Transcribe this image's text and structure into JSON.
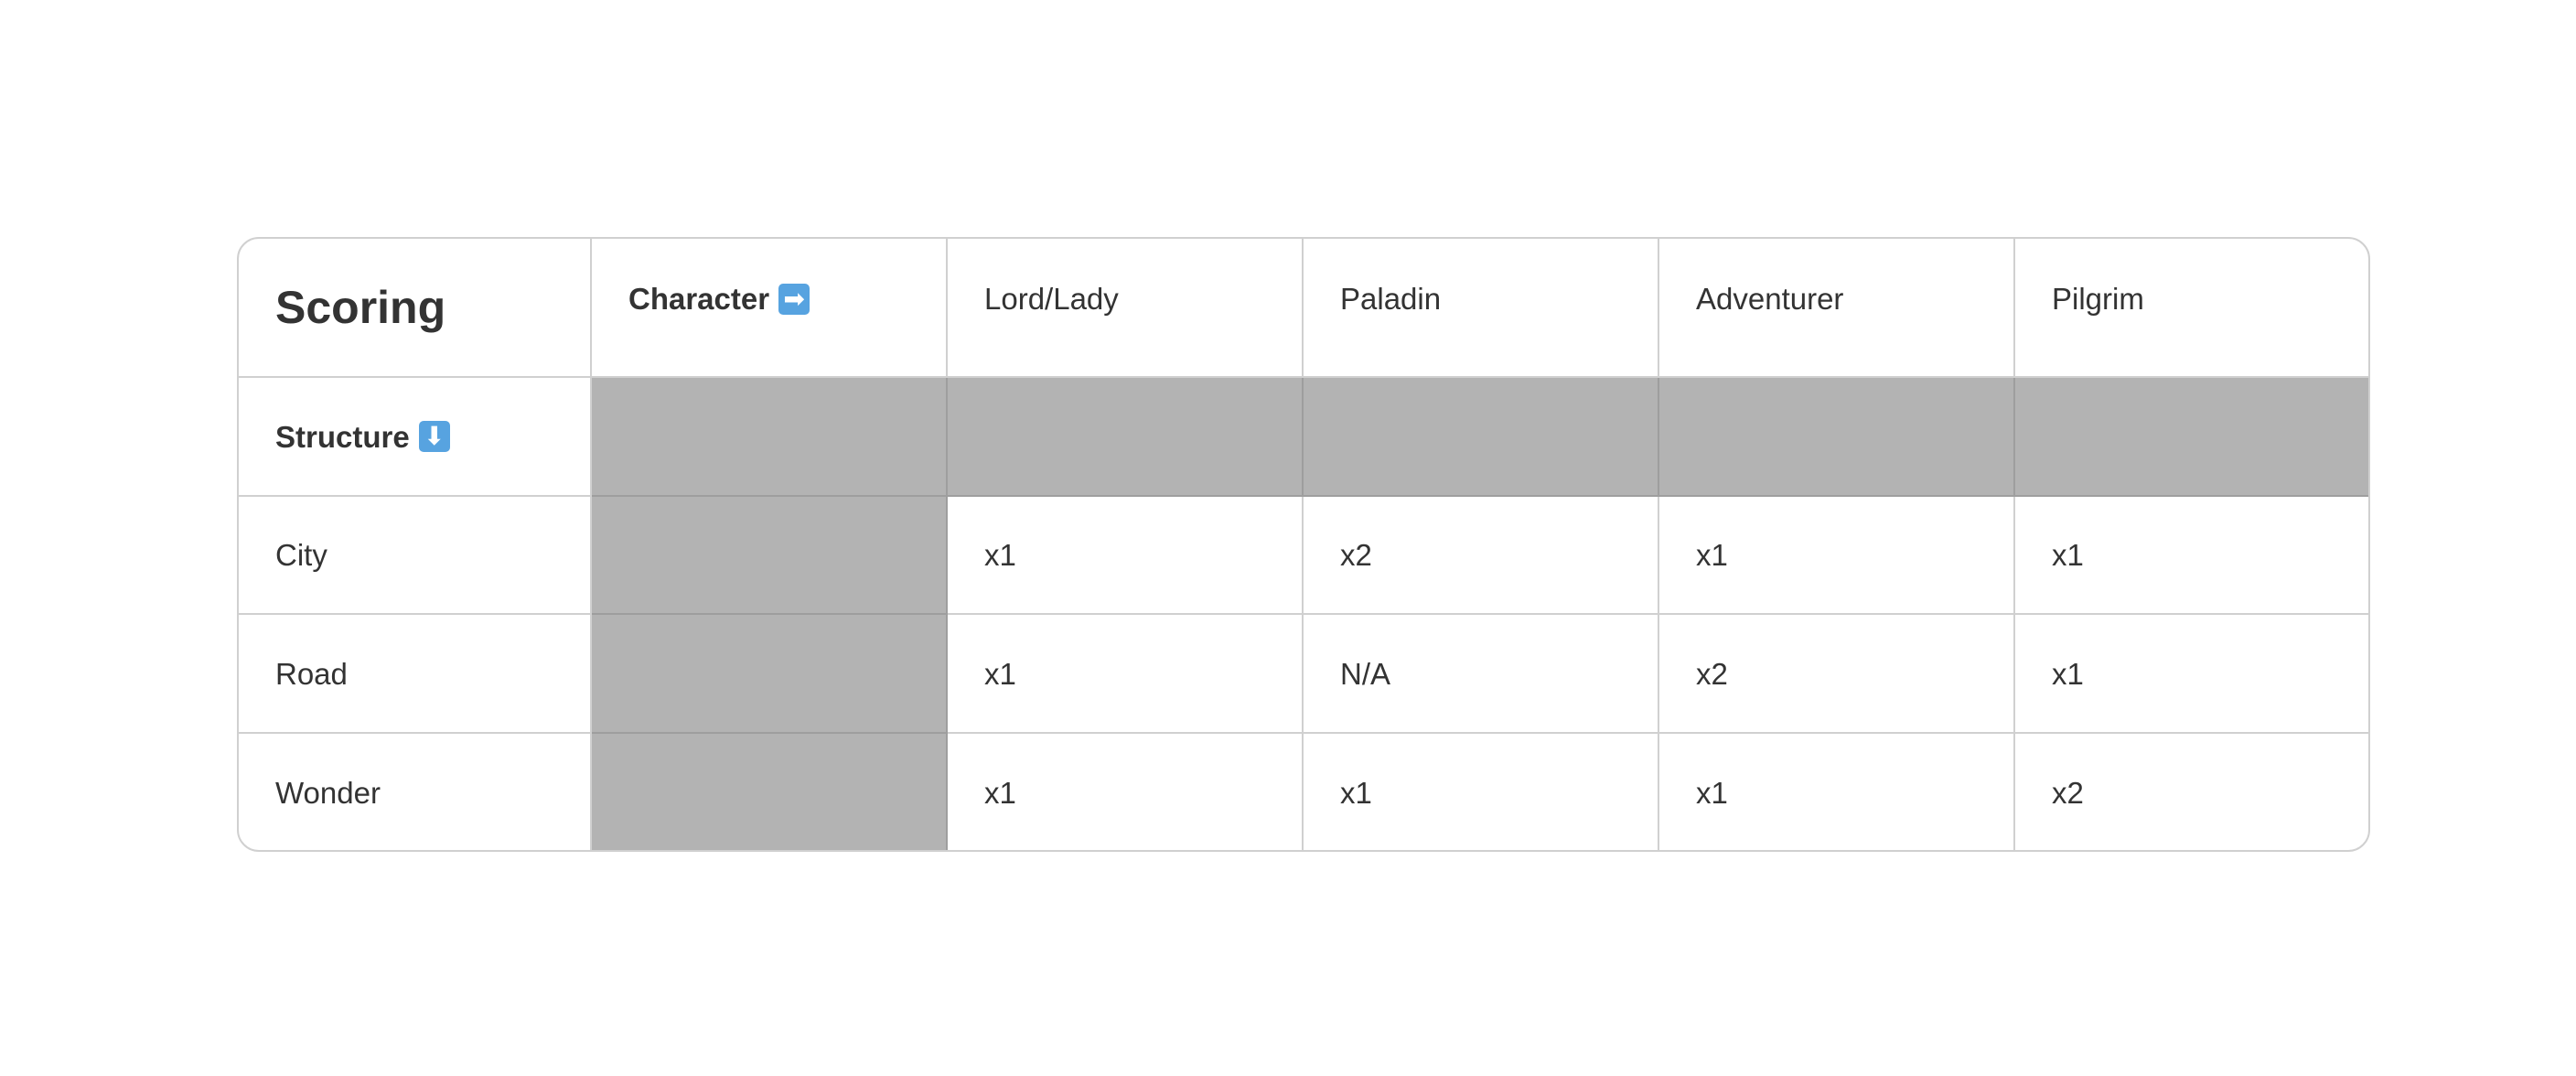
{
  "table": {
    "title": "Scoring",
    "character_header": {
      "label": "Character",
      "icon_glyph": "➡",
      "icon_name": "right-arrow-emoji-icon"
    },
    "structure_header": {
      "label": "Structure",
      "icon_glyph": "⬇",
      "icon_name": "down-arrow-emoji-icon"
    },
    "columns": [
      "Lord/Lady",
      "Paladin",
      "Adventurer",
      "Pilgrim"
    ],
    "rows": [
      {
        "label": "City",
        "values": [
          "x1",
          "x2",
          "x1",
          "x1"
        ]
      },
      {
        "label": "Road",
        "values": [
          "x1",
          "N/A",
          "x2",
          "x1"
        ]
      },
      {
        "label": "Wonder",
        "values": [
          "x1",
          "x1",
          "x1",
          "x2"
        ]
      }
    ],
    "colors": {
      "border": "#d0d0d0",
      "shaded_cell": "#b3b3b3",
      "text": "#333333",
      "emoji_key": "#57a3e0"
    }
  }
}
